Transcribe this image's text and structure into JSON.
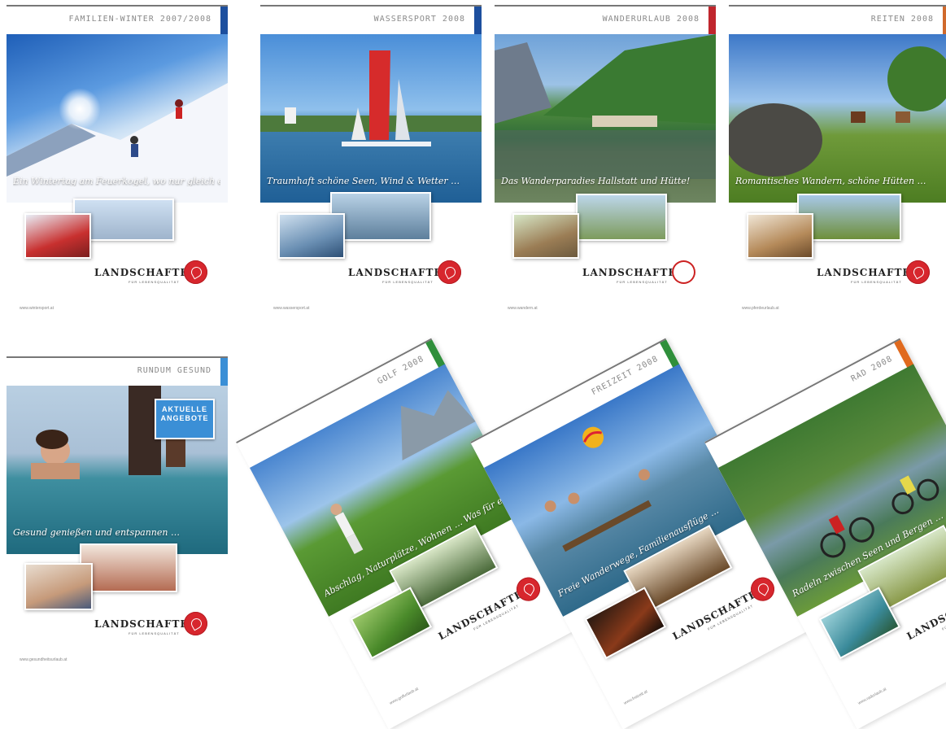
{
  "covers": [
    {
      "title": "FAMILIEN-WINTER 2007/2008",
      "accent": "#1d4f9e",
      "script": "Ein Wintertag am Feuerkogel, wo nur gleich ein Erlebnis …",
      "brand": "LANDSCHAFTEN",
      "url": "www.wintersport.at"
    },
    {
      "title": "WASSERSPORT 2008",
      "accent": "#1d4f9e",
      "script": "Traumhaft schöne Seen, Wind & Wetter …",
      "brand": "LANDSCHAFTEN",
      "url": "www.wassersport.at"
    },
    {
      "title": "WANDERURLAUB 2008",
      "accent": "#c0262d",
      "script": "Das Wanderparadies Hallstatt und Hütte!",
      "brand": "LANDSCHAFTEN",
      "url": "www.wandern.at"
    },
    {
      "title": "REITEN 2008",
      "accent": "#d06a2c",
      "script": "Romantisches Wandern, schöne Hütten …",
      "brand": "LANDSCHAFTEN",
      "url": "www.pferdeurlaub.at"
    },
    {
      "title": "RUNDUM GESUND",
      "accent": "#3b8fd6",
      "script": "Gesund genießen und entspannen …",
      "brand": "LANDSCHAFTEN",
      "url": "www.gesundheitsurlaub.at",
      "badge": "AKTUELLE ANGEBOTE"
    },
    {
      "title": "GOLF 2008",
      "accent": "#2f8f3b",
      "script": "Abschlag, Naturplätze, Wohnen … Was für ein Spaß!",
      "brand": "LANDSCHAFTEN",
      "url": "www.golfurlaub.at"
    },
    {
      "title": "FREIZEIT 2008",
      "accent": "#2f8f3b",
      "script": "Freie Wanderwege, Familienausflüge …",
      "brand": "LANDSCHAFTEN",
      "url": "www.freizeit.at"
    },
    {
      "title": "RAD 2008",
      "accent": "#e06a1e",
      "script": "Radeln zwischen Seen und Bergen …",
      "brand": "LANDSCHAFTEN",
      "url": "www.radurlaub.at"
    }
  ],
  "subline": "FÜR LEBENSQUALITÄT"
}
